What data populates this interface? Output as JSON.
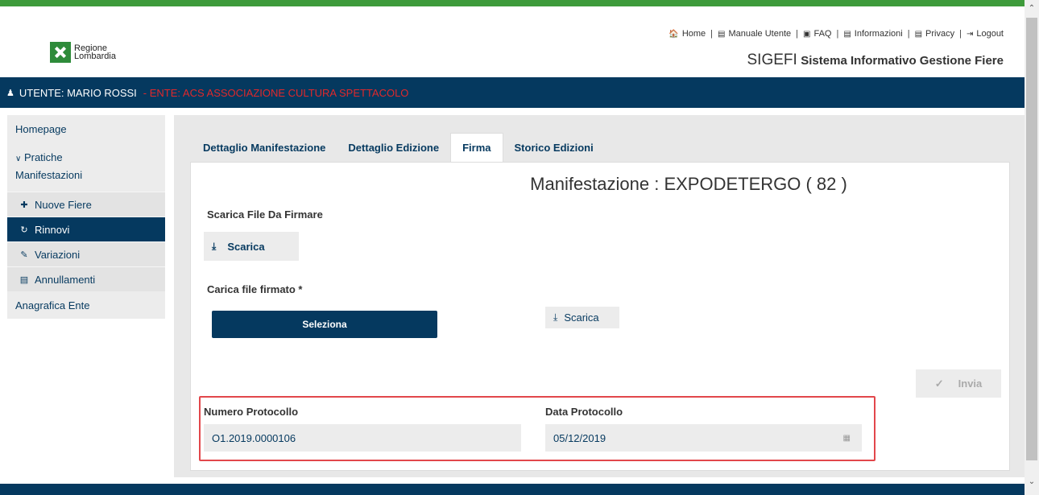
{
  "header": {
    "logo_line1": "Regione",
    "logo_line2": "Lombardia",
    "nav": [
      {
        "icon": "home-icon",
        "glyph": "🏠",
        "label": "Home"
      },
      {
        "icon": "document-icon",
        "glyph": "▤",
        "label": "Manuale Utente"
      },
      {
        "icon": "book-icon",
        "glyph": "▣",
        "label": "FAQ"
      },
      {
        "icon": "document-icon",
        "glyph": "▤",
        "label": "Informazioni"
      },
      {
        "icon": "document-icon",
        "glyph": "▤",
        "label": "Privacy"
      },
      {
        "icon": "logout-icon",
        "glyph": "⇥",
        "label": "Logout"
      }
    ],
    "app_acronym": "SIGEFI",
    "app_full_name": "Sistema Informativo Gestione Fiere"
  },
  "userbar": {
    "user": "UTENTE: MARIO ROSSI",
    "ente": "- ENTE: ACS ASSOCIAZIONE CULTURA SPETTACOLO"
  },
  "sidebar": {
    "homepage": "Homepage",
    "pratiche_line1": "Pratiche",
    "pratiche_line2": "Manifestazioni",
    "nuove": "Nuove Fiere",
    "rinnovi": "Rinnovi",
    "variazioni": "Variazioni",
    "annullamenti": "Annullamenti",
    "anagrafica": "Anagrafica Ente"
  },
  "tabs": [
    "Dettaglio Manifestazione",
    "Dettaglio Edizione",
    "Firma",
    "Storico Edizioni"
  ],
  "main": {
    "title": "Manifestazione : EXPODETERGO ( 82 )",
    "scarica_file_label": "Scarica File Da Firmare",
    "scarica_btn": "Scarica",
    "carica_label": "Carica file firmato *",
    "seleziona_btn": "Seleziona",
    "scarica_btn2": "Scarica",
    "invia_btn": "Invia",
    "numero_label": "Numero Protocollo",
    "numero_value": "O1.2019.0000106",
    "data_label": "Data Protocollo",
    "data_value": "05/12/2019"
  },
  "colors": {
    "brand_blue": "#05395f",
    "brand_green": "#3e9b3b",
    "ente_red": "#e0282b",
    "highlight_red": "#e2474b"
  }
}
